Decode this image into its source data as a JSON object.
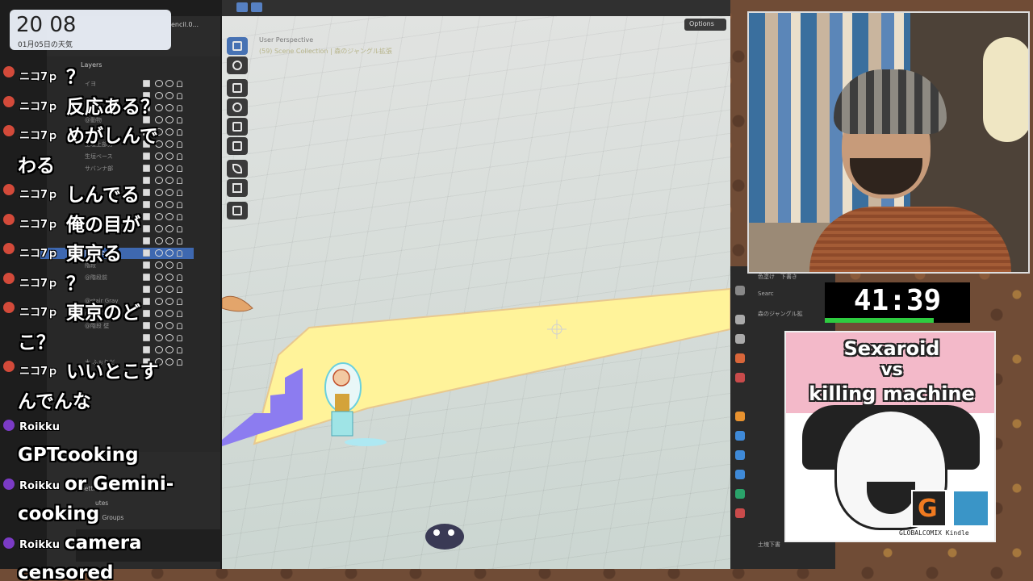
{
  "clock": {
    "time": "20 08",
    "date": "01月05日の天気",
    "scene_name_partial": "encil.0..."
  },
  "blender": {
    "outliner": {
      "layers_title": "Layers",
      "items": [
        {
          "label": "イヨ",
          "selected": false
        },
        {
          "label": "",
          "selected": false
        },
        {
          "label": "",
          "selected": false
        },
        {
          "label": "@動物",
          "selected": false
        },
        {
          "label": "",
          "selected": false
        },
        {
          "label": "生垣上部分",
          "selected": false
        },
        {
          "label": "生垣ベース",
          "selected": false
        },
        {
          "label": "サバンナ部",
          "selected": false
        },
        {
          "label": "",
          "selected": false
        },
        {
          "label": "",
          "selected": false
        },
        {
          "label": "",
          "selected": false
        },
        {
          "label": "",
          "selected": false
        },
        {
          "label": "",
          "selected": false
        },
        {
          "label": "",
          "selected": false
        },
        {
          "label": "階段.001",
          "selected": true
        },
        {
          "label": "階段",
          "selected": false
        },
        {
          "label": "@階段前",
          "selected": false
        },
        {
          "label": "",
          "selected": false
        },
        {
          "label": "@stair Gray",
          "selected": false
        },
        {
          "label": "@階段下",
          "selected": false
        },
        {
          "label": "@階段 壁",
          "selected": false
        },
        {
          "label": "",
          "selected": false
        },
        {
          "label": "",
          "selected": false
        },
        {
          "label": "木 ふぉりだ",
          "selected": false
        }
      ]
    },
    "properties": {
      "display": "Display",
      "settings": "Settings",
      "attributes_partial": "utes",
      "vertex_groups": "Vertex Groups"
    },
    "viewport": {
      "perspective": "User Perspective",
      "collection": "(59) Scene Collection | 森のジャングル拡張",
      "options": "Options"
    },
    "right_panel": {
      "collection": "森のジャングル拡",
      "search_partial": "Searc",
      "top_partial": "色塗け　下書き",
      "bottom_partial": "土塊下書"
    }
  },
  "chat": [
    {
      "user": "ニコ7ｐ",
      "text": "？",
      "badge": "red"
    },
    {
      "user": "ニコ7ｐ",
      "text": "反応ある？",
      "badge": "red"
    },
    {
      "user": "ニコ7ｐ",
      "text": "めがしんで",
      "badge": "red"
    },
    {
      "user": "",
      "text": "わる",
      "badge": "none"
    },
    {
      "user": "ニコ7ｐ",
      "text": "しんでる",
      "badge": "red"
    },
    {
      "user": "ニコ7ｐ",
      "text": "俺の目が",
      "badge": "red"
    },
    {
      "user": "ニコ7ｐ",
      "text": "東京る",
      "badge": "red"
    },
    {
      "user": "ニコ7ｐ",
      "text": "？",
      "badge": "red"
    },
    {
      "user": "ニコ7ｐ",
      "text": "東京のど",
      "badge": "red"
    },
    {
      "user": "",
      "text": "こ？",
      "badge": "none"
    },
    {
      "user": "ニコ7ｐ",
      "text": "いいとこす",
      "badge": "red"
    },
    {
      "user": "",
      "text": "んでんな",
      "badge": "none"
    },
    {
      "user": "Roikku",
      "text": "",
      "badge": "purple"
    },
    {
      "user": "",
      "text": "GPTcooking",
      "badge": "none"
    },
    {
      "user": "Roikku",
      "text": "or Gemini-",
      "badge": "purple"
    },
    {
      "user": "",
      "text": "cooking",
      "badge": "none"
    },
    {
      "user": "Roikku",
      "text": "camera",
      "badge": "purple"
    },
    {
      "user": "",
      "text": "censored",
      "badge": "none"
    }
  ],
  "timer": {
    "value": "41:39",
    "progress": 0.75
  },
  "promo": {
    "title1": "Sexaroid",
    "title2": "vs",
    "title3": "killing machine",
    "footer": "GLOBALCOMIX  Kindle"
  },
  "colors": {
    "timer_bar": "#2ecc40",
    "selection": "#3e68b0",
    "road": "#fff39a",
    "stairs": "#8c7cf0"
  }
}
